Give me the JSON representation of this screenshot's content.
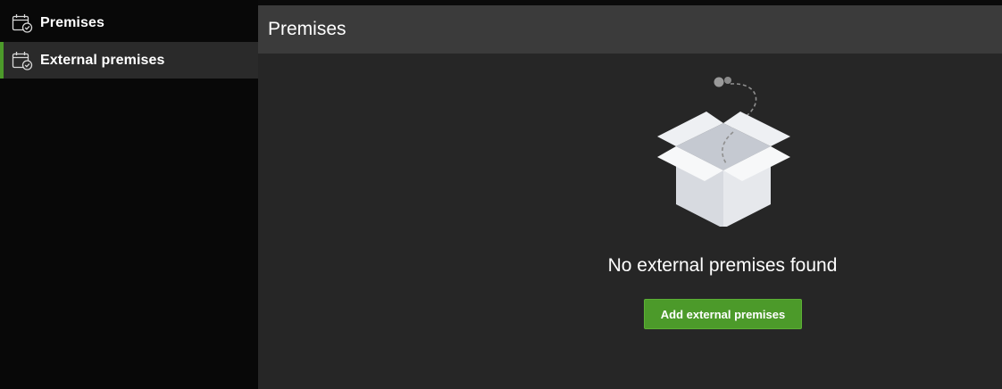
{
  "sidebar": {
    "items": [
      {
        "label": "Premises",
        "icon": "calendar-check-icon",
        "active": false
      },
      {
        "label": "External premises",
        "icon": "calendar-check-icon",
        "active": true
      }
    ]
  },
  "main": {
    "title": "Premises",
    "empty_state": {
      "illustration": "open-box-icon",
      "message": "No external premises found",
      "action_label": "Add external premises"
    }
  },
  "colors": {
    "accent": "#4c9a2a",
    "sidebar_bg": "#080808",
    "active_item_bg": "#2a2a2a",
    "main_bg": "#262626",
    "header_bg": "#3b3b3b"
  }
}
